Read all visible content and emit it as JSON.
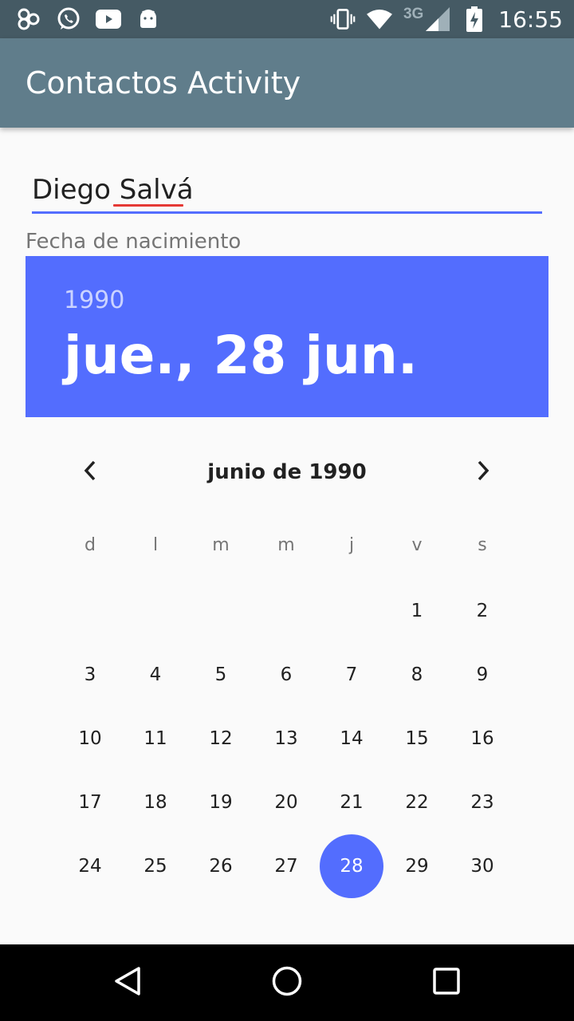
{
  "status_bar": {
    "left_icons": [
      "beats-icon",
      "whatsapp-icon",
      "youtube-icon",
      "android-icon"
    ],
    "network_type": "3G",
    "time": "16:55"
  },
  "app_bar": {
    "title": "Contactos Activity"
  },
  "form": {
    "name_value": "Diego Salvá",
    "birth_label": "Fecha de nacimiento"
  },
  "date_picker": {
    "header_year": "1990",
    "header_date": "jue., 28 jun.",
    "month_title": "junio de 1990",
    "weekdays": [
      "d",
      "l",
      "m",
      "m",
      "j",
      "v",
      "s"
    ],
    "weeks": [
      [
        "",
        "",
        "",
        "",
        "",
        "1",
        "2"
      ],
      [
        "3",
        "4",
        "5",
        "6",
        "7",
        "8",
        "9"
      ],
      [
        "10",
        "11",
        "12",
        "13",
        "14",
        "15",
        "16"
      ],
      [
        "17",
        "18",
        "19",
        "20",
        "21",
        "22",
        "23"
      ],
      [
        "24",
        "25",
        "26",
        "27",
        "28",
        "29",
        "30"
      ]
    ],
    "selected_day": "28"
  },
  "colors": {
    "status_bar": "#455a64",
    "app_bar": "#607d8b",
    "accent": "#536dfe",
    "spell_error": "#e53935",
    "nav_bar": "#000000"
  }
}
